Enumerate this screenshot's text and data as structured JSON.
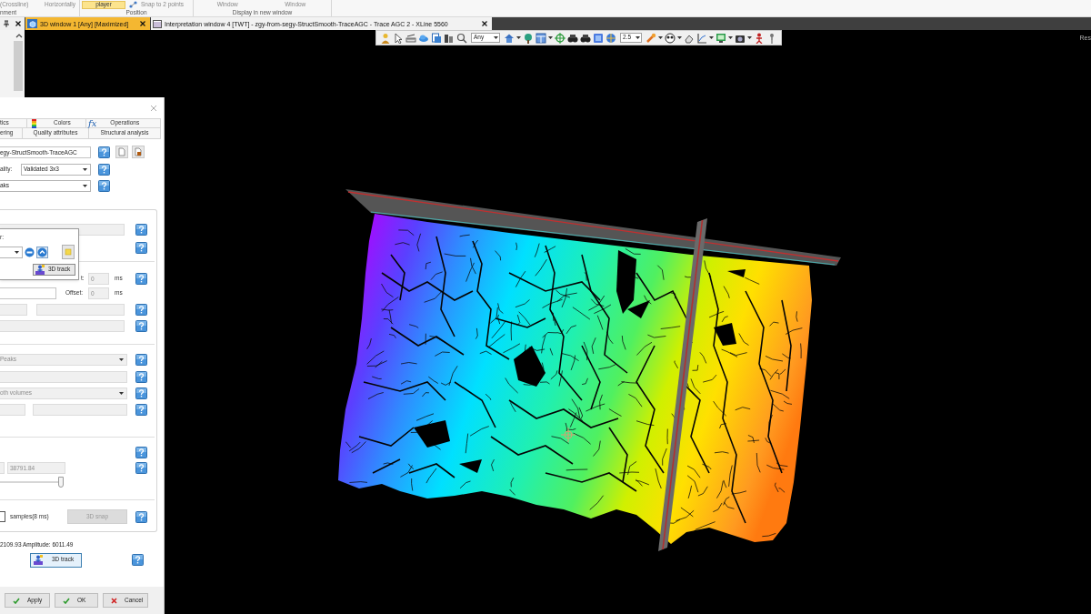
{
  "ribbon": {
    "groups": [
      {
        "label": "nment",
        "items": [
          {
            "kind": "text",
            "label": "(Crossline)"
          },
          {
            "kind": "text",
            "label": "Horizontally"
          }
        ]
      },
      {
        "label": "Position",
        "items": [
          {
            "kind": "toggle",
            "label": "player",
            "on": true
          },
          {
            "kind": "snap",
            "label": "Snap to 2 points"
          }
        ]
      },
      {
        "label": "Display in new window",
        "items": [
          {
            "kind": "text",
            "label": "Window"
          },
          {
            "kind": "text",
            "label": "Window"
          }
        ]
      }
    ]
  },
  "tabs": [
    {
      "kind": "viewer",
      "label": "3D window 1 [Any] [Maximized]",
      "selected": true
    },
    {
      "kind": "section",
      "label": "Interpretation window 4 [TWT] - zgy-from-segy-StructSmooth-TraceAGC - Trace AGC 2 - XLine 5560",
      "selected": false
    }
  ],
  "toolbar": {
    "dropdowns": [
      {
        "value": "Any"
      },
      {
        "value": "2.5"
      }
    ]
  },
  "corner_label": "Res",
  "dialog": {
    "tab_rows": [
      [
        {
          "kind": "plain",
          "label": "tics"
        },
        {
          "kind": "colors",
          "label": "Colors"
        },
        {
          "kind": "formula",
          "label": "Operations",
          "icon_text": "fx"
        }
      ],
      [
        {
          "kind": "plain",
          "label": "ering"
        },
        {
          "kind": "plain",
          "label": "Quality attributes"
        },
        {
          "kind": "plain",
          "label": "Structural analysis"
        }
      ]
    ],
    "volume": {
      "value": "egy-StructSmooth-TraceAGC"
    },
    "quality": {
      "label": "ality:",
      "value": "Validated 3x3"
    },
    "extrema": {
      "value": "aks"
    },
    "popup": {
      "label": "r:",
      "button": "3D track"
    },
    "window_start": {
      "label": "t:",
      "value": "0",
      "unit": "ms",
      "disabled": true
    },
    "offset": {
      "label": "Offset:",
      "value": "0",
      "unit": "ms",
      "disabled": true
    },
    "peaks": {
      "value": "Peaks",
      "disabled": true
    },
    "volumes": {
      "value": "oth volumes",
      "disabled": true
    },
    "range": {
      "value": "38791.84",
      "disabled": true,
      "level": 0.95
    },
    "snap": {
      "checked": false,
      "label": "samples(8 ms)",
      "button": "3D snap",
      "disabled": true
    },
    "status": "2109.93 Amplitude: 6011.49",
    "track_button": "3D track",
    "buttons": [
      {
        "kind": "apply",
        "label": "Apply"
      },
      {
        "kind": "ok",
        "label": "OK"
      },
      {
        "kind": "cancel",
        "label": "Cancel"
      }
    ]
  }
}
